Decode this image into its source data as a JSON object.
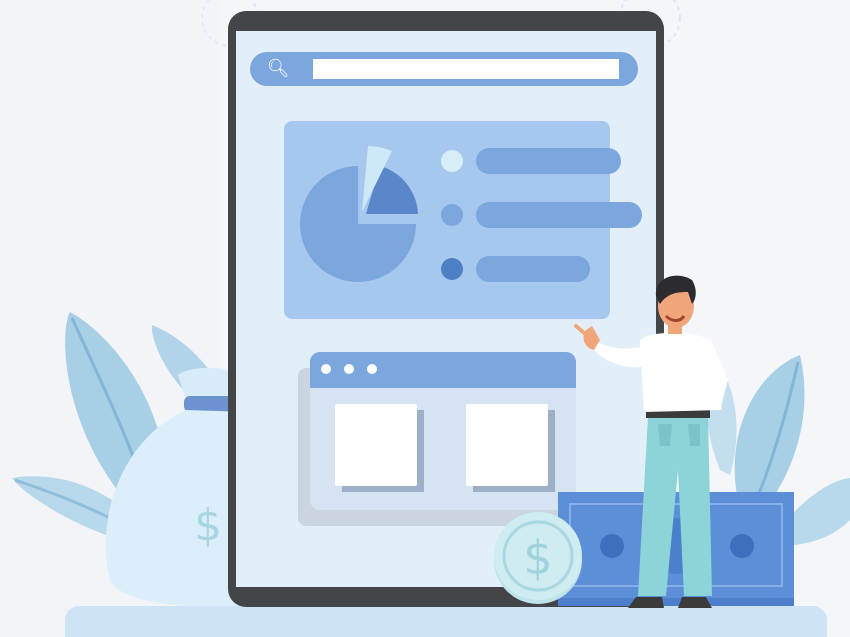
{
  "search": {
    "placeholder": "",
    "value": ""
  },
  "icons": [
    "search-icon",
    "pie-chart-icon",
    "dollar-icon",
    "coin-icon",
    "money-bag-icon",
    "leaf-icon"
  ],
  "colors": {
    "tablet_frame": "#434548",
    "screen": "#e3eff8",
    "accent_blue": "#7ba6de",
    "card": "#a6c8ee",
    "pie_light": "#cde8f6",
    "pie_mid": "#7ba6de",
    "pie_dark": "#5a87c9",
    "dot_light": "#d7eef7",
    "dot_mid": "#7ba6de",
    "dot_dark": "#4d7fc4",
    "money_bag": "#dceefa",
    "bill": "#5d8fd9",
    "coin": "#cfecf1",
    "leaves": "#a7cfe6",
    "shirt": "#ffffff",
    "pants": "#8dd4d8",
    "floor": "#cfe3f6"
  },
  "symbols": {
    "dollar": "$"
  }
}
